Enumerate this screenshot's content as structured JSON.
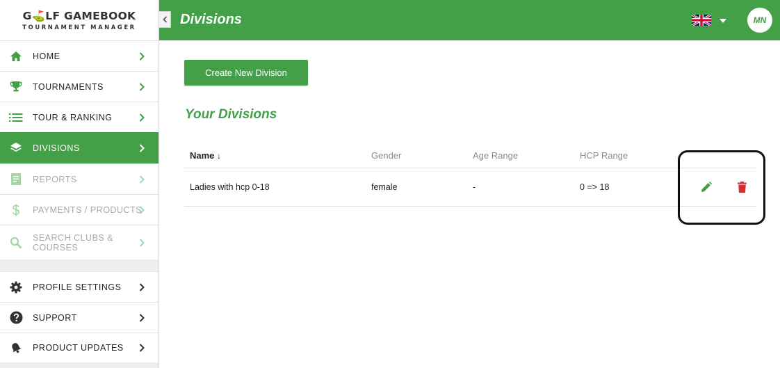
{
  "logo": {
    "pre": "G",
    "mark": "⛳",
    "rest": "LF GAMEBOOK",
    "sub": "TOURNAMENT MANAGER"
  },
  "sidebar": {
    "items": [
      {
        "label": "HOME",
        "icon": "home-icon"
      },
      {
        "label": "TOURNAMENTS",
        "icon": "trophy-icon"
      },
      {
        "label": "TOUR & RANKING",
        "icon": "list-icon"
      },
      {
        "label": "DIVISIONS",
        "icon": "layers-icon",
        "active": true
      },
      {
        "label": "REPORTS",
        "icon": "document-icon",
        "disabled": true
      },
      {
        "label": "PAYMENTS / PRODUCTS",
        "icon": "dollar-icon",
        "disabled": true
      },
      {
        "label": "SEARCH CLUBS &",
        "label2": "COURSES",
        "icon": "search-icon",
        "disabled": true
      },
      {
        "label": "PROFILE SETTINGS",
        "icon": "gear-icon"
      },
      {
        "label": "SUPPORT",
        "icon": "help-icon"
      },
      {
        "label": "PRODUCT UPDATES",
        "icon": "bell-icon"
      }
    ]
  },
  "header": {
    "title": "Divisions",
    "language_flag": "uk-flag-icon",
    "avatar_initials": "MN"
  },
  "main": {
    "create_button": "Create New Division",
    "section_title": "Your Divisions",
    "table": {
      "columns": [
        "Name",
        "Gender",
        "Age Range",
        "HCP Range"
      ],
      "sort_indicator": "↓",
      "rows": [
        {
          "name": "Ladies with hcp 0-18",
          "gender": "female",
          "age_range": "-",
          "hcp_range": "0 => 18"
        }
      ]
    }
  },
  "colors": {
    "brand": "#43a047",
    "delete": "#d32f2f",
    "disabled_text": "#a8a8a8"
  }
}
